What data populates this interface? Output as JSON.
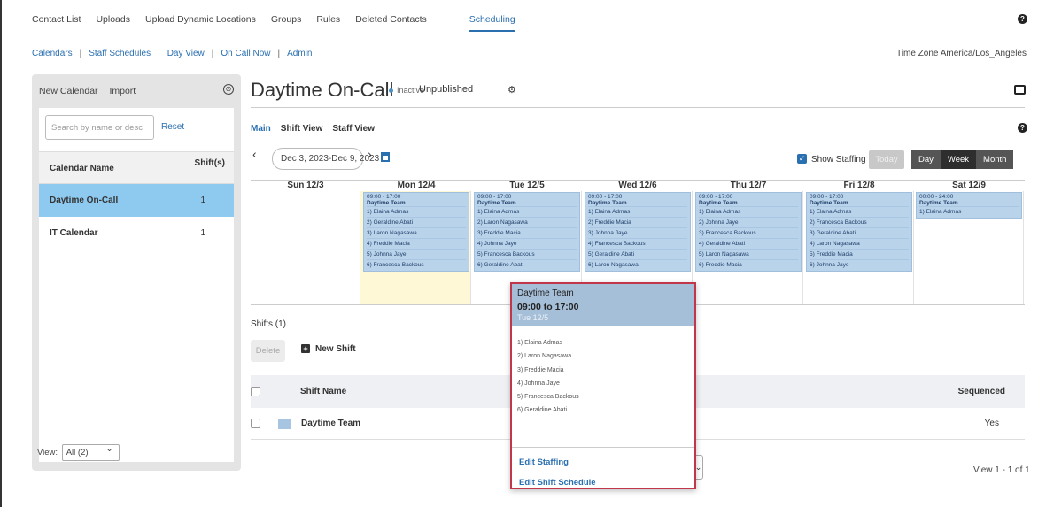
{
  "top_nav": [
    "Contact List",
    "Uploads",
    "Upload Dynamic Locations",
    "Groups",
    "Rules",
    "Deleted Contacts",
    "Scheduling"
  ],
  "active_top_nav": "Scheduling",
  "sub_nav": [
    "Calendars",
    "Staff Schedules",
    "Day View",
    "On Call Now",
    "Admin"
  ],
  "time_zone": "Time Zone America/Los_Angeles",
  "left_panel": {
    "new_calendar": "New Calendar",
    "import": "Import",
    "search_placeholder": "Search by name or desc",
    "reset": "Reset",
    "col_name": "Calendar Name",
    "col_shifts": "Shift(s)",
    "rows": [
      {
        "name": "Daytime On-Call",
        "count": "1",
        "selected": true
      },
      {
        "name": "IT Calendar",
        "count": "1",
        "selected": false
      }
    ],
    "view_label": "View:",
    "view_value": "All (2)"
  },
  "calendar": {
    "title": "Daytime On-Call",
    "status": "Inactive",
    "publish": "Unpublished",
    "tabs": [
      "Main",
      "Shift View",
      "Staff View"
    ],
    "date_range": "Dec 3, 2023-Dec 9, 2023",
    "show_staffing": "Show Staffing",
    "today": "Today",
    "modes": [
      "Day",
      "Week",
      "Month"
    ],
    "active_mode": "Week",
    "days": [
      {
        "label": "Sun 12/3",
        "time": "",
        "team": "",
        "staff": []
      },
      {
        "label": "Mon 12/4",
        "time": "09:00 - 17:00",
        "team": "Daytime Team",
        "staff": [
          "1) Elaina Admas",
          "2) Geraldine Abati",
          "3) Laron Nagasawa",
          "4) Freddie Macia",
          "5) Johnna Jaye",
          "6) Francesca Backous"
        ]
      },
      {
        "label": "Tue 12/5",
        "time": "09:00 - 17:00",
        "team": "Daytime Team",
        "staff": [
          "1) Elaina Admas",
          "2) Laron Nagasawa",
          "3) Freddie Macia",
          "4) Johnna Jaye",
          "5) Francesca Backous",
          "6) Geraldine Abati"
        ]
      },
      {
        "label": "Wed 12/6",
        "time": "09:00 - 17:00",
        "team": "Daytime Team",
        "staff": [
          "1) Elaina Admas",
          "2) Freddie Macia",
          "3) Johnna Jaye",
          "4) Francesca Backous",
          "5) Geraldine Abati",
          "6) Laron Nagasawa"
        ]
      },
      {
        "label": "Thu 12/7",
        "time": "09:00 - 17:00",
        "team": "Daytime Team",
        "staff": [
          "1) Elaina Admas",
          "2) Johnna Jaye",
          "3) Francesca Backous",
          "4) Geraldine Abati",
          "5) Laron Nagasawa",
          "6) Freddie Macia"
        ]
      },
      {
        "label": "Fri 12/8",
        "time": "09:00 - 17:00",
        "team": "Daytime Team",
        "staff": [
          "1) Elaina Admas",
          "2) Francesca Backous",
          "3) Geraldine Abati",
          "4) Laron Nagasawa",
          "5) Freddie Macia",
          "6) Johnna Jaye"
        ]
      },
      {
        "label": "Sat 12/9",
        "time": "00:00 - 24:00",
        "team": "Daytime Team",
        "staff": [
          "1) Elaina Admas"
        ]
      }
    ]
  },
  "shifts": {
    "header": "Shifts (1)",
    "delete": "Delete",
    "new_shift": "New Shift",
    "col_name": "Shift Name",
    "col_seq": "Sequenced",
    "rows": [
      {
        "name": "Daytime Team",
        "sequenced": "Yes"
      }
    ],
    "pager": "View 1 - 1 of 1"
  },
  "popup": {
    "team": "Daytime Team",
    "time": "09:00 to 17:00",
    "day": "Tue 12/5",
    "staff": [
      "1) Elaina Admas",
      "2) Laron Nagasawa",
      "3) Freddie Macia",
      "4) Johnna Jaye",
      "5) Francesca Backous",
      "6) Geraldine Abati"
    ],
    "edit_staffing": "Edit Staffing",
    "edit_schedule": "Edit Shift Schedule"
  },
  "colors": {
    "accent": "#2a6fb0",
    "selected_row": "#8ecaf0",
    "event": "#b9d3eb",
    "popup_border": "#c0364b"
  }
}
